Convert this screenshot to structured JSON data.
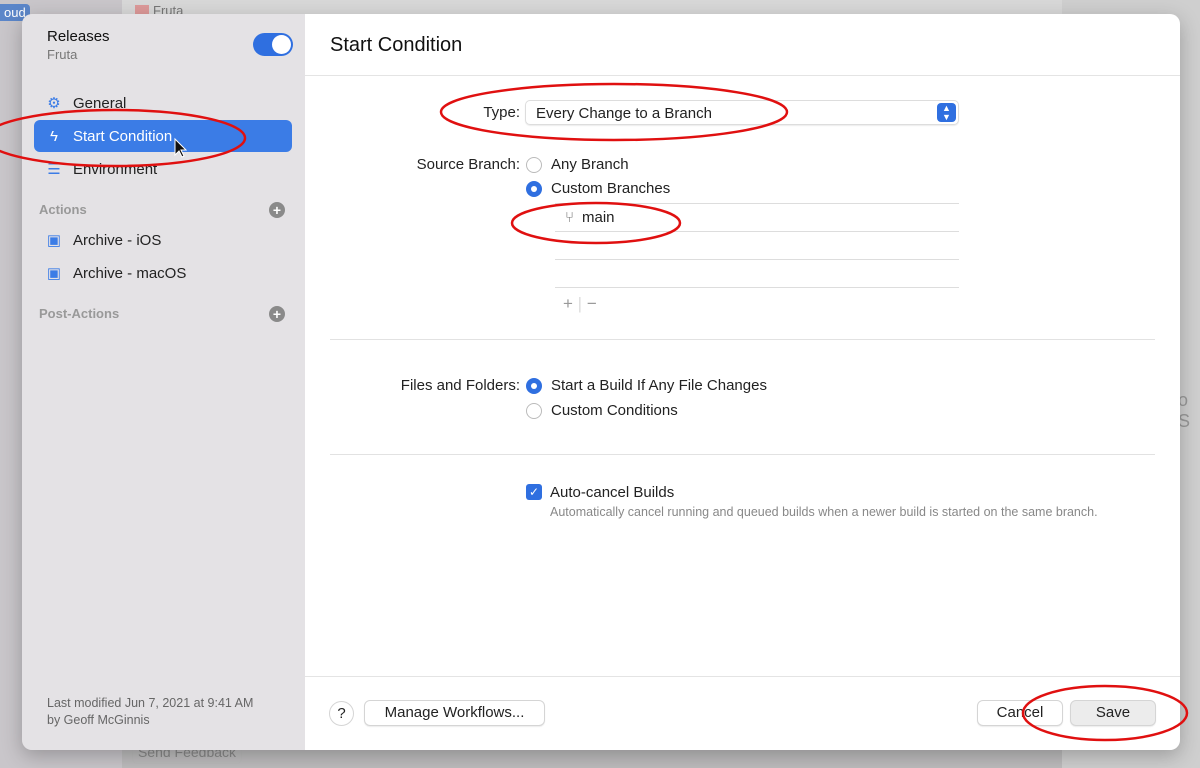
{
  "background": {
    "badge": "oud",
    "project": "Fruta",
    "send_feedback": "Send Feedback",
    "right_partial": "o S"
  },
  "sidebar": {
    "title": "Releases",
    "subtitle": "Fruta",
    "enabled": true,
    "items": [
      {
        "label": "General",
        "icon": "gear-icon"
      },
      {
        "label": "Start Condition",
        "icon": "bolt-icon",
        "selected": true
      },
      {
        "label": "Environment",
        "icon": "server-icon"
      }
    ],
    "actions_header": "Actions",
    "actions": [
      {
        "label": "Archive - iOS",
        "icon": "app-archive-icon"
      },
      {
        "label": "Archive - macOS",
        "icon": "app-archive-icon"
      }
    ],
    "post_actions_header": "Post-Actions",
    "modified_line1": "Last modified Jun 7, 2021 at 9:41 AM",
    "modified_line2": "by Geoff McGinnis"
  },
  "main": {
    "title": "Start Condition",
    "type_label": "Type:",
    "type_value": "Every Change to a Branch",
    "source_branch_label": "Source Branch:",
    "source_any": "Any Branch",
    "source_custom": "Custom Branches",
    "source_selected": "Custom Branches",
    "branches": [
      "main"
    ],
    "files_label": "Files and Folders:",
    "files_any": "Start a Build If Any File Changes",
    "files_custom": "Custom Conditions",
    "files_selected": "Start a Build If Any File Changes",
    "autocancel_label": "Auto-cancel Builds",
    "autocancel_checked": true,
    "autocancel_desc": "Automatically cancel running and queued builds when a newer build is started on the same branch."
  },
  "footer": {
    "help": "?",
    "manage": "Manage Workflows...",
    "cancel": "Cancel",
    "save": "Save"
  },
  "colors": {
    "accent": "#3b7ce6",
    "annotation": "#e01010"
  }
}
